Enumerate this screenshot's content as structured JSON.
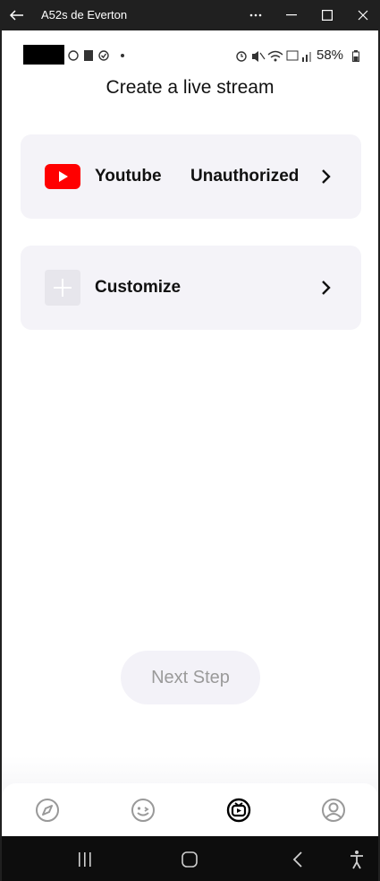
{
  "window": {
    "title": "A52s de Everton"
  },
  "status_bar": {
    "battery": "58%"
  },
  "page": {
    "heading": "Create a live stream"
  },
  "options": [
    {
      "label": "Youtube",
      "status": "Unauthorized"
    },
    {
      "label": "Customize",
      "status": ""
    }
  ],
  "next_button": {
    "label": "Next Step"
  },
  "tab_bar": {
    "tabs": [
      "explore-icon",
      "emoji-icon",
      "live-icon",
      "profile-icon"
    ]
  },
  "colors": {
    "youtube_red": "#ff0000",
    "card_bg": "#f4f3f8",
    "button_bg": "#f3f2f8"
  }
}
